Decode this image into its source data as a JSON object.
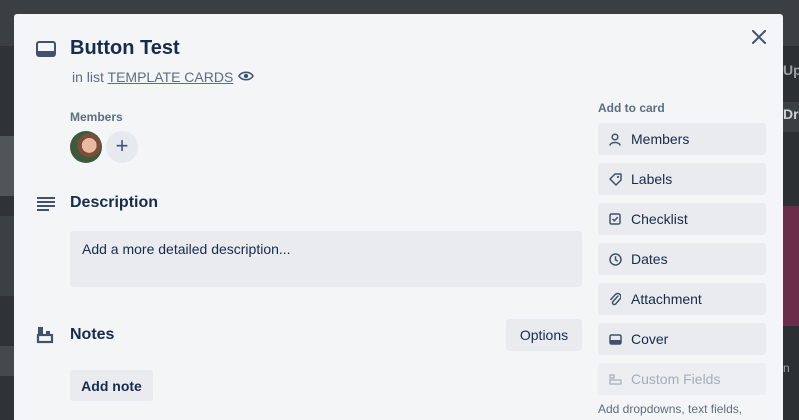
{
  "backdrop": {
    "right_labels": [
      "Up",
      "Dra",
      "n"
    ]
  },
  "card": {
    "title": "Button Test",
    "in_list_prefix": "in list",
    "list_name": "TEMPLATE CARDS"
  },
  "members": {
    "label": "Members"
  },
  "description": {
    "title": "Description",
    "placeholder": "Add a more detailed description..."
  },
  "notes": {
    "title": "Notes",
    "options_label": "Options",
    "add_note_label": "Add note"
  },
  "sidebar": {
    "heading": "Add to card",
    "items": [
      {
        "label": "Members",
        "icon": "person-icon"
      },
      {
        "label": "Labels",
        "icon": "tag-icon"
      },
      {
        "label": "Checklist",
        "icon": "checkbox-icon"
      },
      {
        "label": "Dates",
        "icon": "clock-icon"
      },
      {
        "label": "Attachment",
        "icon": "paperclip-icon"
      },
      {
        "label": "Cover",
        "icon": "cover-icon"
      },
      {
        "label": "Custom Fields",
        "icon": "custom-fields-icon"
      }
    ],
    "hint": "Add dropdowns, text fields,"
  }
}
